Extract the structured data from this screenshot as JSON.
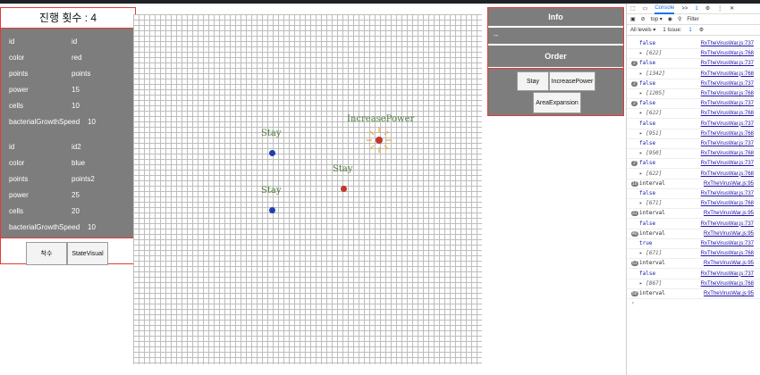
{
  "app": {
    "progress_title": "진행 횟수 : 4"
  },
  "left_panel": {
    "players": [
      {
        "rows": [
          {
            "key": "id",
            "value": "id"
          },
          {
            "key": "color",
            "value": "red"
          },
          {
            "key": "points",
            "value": "points"
          },
          {
            "key": "power",
            "value": "15"
          },
          {
            "key": "cells",
            "value": "10"
          },
          {
            "key": "bacterialGrowthSpeed",
            "value": "10"
          }
        ]
      },
      {
        "rows": [
          {
            "key": "id",
            "value": "id2"
          },
          {
            "key": "color",
            "value": "blue"
          },
          {
            "key": "points",
            "value": "points2"
          },
          {
            "key": "power",
            "value": "25"
          },
          {
            "key": "cells",
            "value": "20"
          },
          {
            "key": "bacterialGrowthSpeed",
            "value": "10"
          }
        ]
      }
    ],
    "buttons": {
      "start": "착수",
      "state_visual": "StateVisual"
    }
  },
  "map": {
    "labels": {
      "blue_top": "Stay",
      "blue_bottom": "Stay",
      "red_top": "IncreasePower",
      "red_bottom": "Stay"
    },
    "colors": {
      "blue": "#1f3fae",
      "red": "#c0392b",
      "label": "#4d7a3e",
      "burst": "#f5a623"
    }
  },
  "right_panel": {
    "info_title": "Info",
    "info_text": "--",
    "order_title": "Order",
    "buttons": {
      "stay": "Stay",
      "increase_power": "IncreasePower",
      "area_expansion": "AreaExpansion"
    }
  },
  "devtools": {
    "tabs": {
      "console": "Console",
      "more": ">>",
      "issues_count": "1"
    },
    "context": "top ▾",
    "filter_placeholder": "Filter",
    "levels": "All levels ▾",
    "issues_label": "1 Issue:",
    "issues_badge": "1",
    "logs": [
      {
        "badge": "",
        "msg": "false",
        "kind": "val",
        "src": "RxTheVirusWar.js:737"
      },
      {
        "badge": "",
        "msg": "▸ [622]",
        "kind": "arr",
        "src": "RxTheVirusWar.js:768"
      },
      {
        "badge": "2",
        "msg": "false",
        "kind": "val",
        "src": "RxTheVirusWar.js:737"
      },
      {
        "badge": "",
        "msg": "▸ [1342]",
        "kind": "arr",
        "src": "RxTheVirusWar.js:768"
      },
      {
        "badge": "2",
        "msg": "false",
        "kind": "val",
        "src": "RxTheVirusWar.js:737"
      },
      {
        "badge": "",
        "msg": "▸ [1205]",
        "kind": "arr",
        "src": "RxTheVirusWar.js:768"
      },
      {
        "badge": "2",
        "msg": "false",
        "kind": "val",
        "src": "RxTheVirusWar.js:737"
      },
      {
        "badge": "",
        "msg": "▸ [622]",
        "kind": "arr",
        "src": "RxTheVirusWar.js:768"
      },
      {
        "badge": "",
        "msg": "false",
        "kind": "val",
        "src": "RxTheVirusWar.js:737"
      },
      {
        "badge": "",
        "msg": "▸ [951]",
        "kind": "arr",
        "src": "RxTheVirusWar.js:768"
      },
      {
        "badge": "",
        "msg": "false",
        "kind": "val",
        "src": "RxTheVirusWar.js:737"
      },
      {
        "badge": "",
        "msg": "▸ [950]",
        "kind": "arr",
        "src": "RxTheVirusWar.js:768"
      },
      {
        "badge": "2",
        "msg": "false",
        "kind": "val",
        "src": "RxTheVirusWar.js:737"
      },
      {
        "badge": "",
        "msg": "▸ [622]",
        "kind": "arr",
        "src": "RxTheVirusWar.js:768"
      },
      {
        "badge": "10",
        "msg": "interval",
        "kind": "plain",
        "src": "RxTheVirusWar.js:95"
      },
      {
        "badge": "",
        "msg": "false",
        "kind": "val",
        "src": "RxTheVirusWar.js:737"
      },
      {
        "badge": "",
        "msg": "▸ [671]",
        "kind": "arr",
        "src": "RxTheVirusWar.js:768"
      },
      {
        "badge": "31",
        "msg": "interval",
        "kind": "plain",
        "src": "RxTheVirusWar.js:95"
      },
      {
        "badge": "",
        "msg": "false",
        "kind": "val",
        "src": "RxTheVirusWar.js:737"
      },
      {
        "badge": "40",
        "msg": "interval",
        "kind": "plain",
        "src": "RxTheVirusWar.js:95"
      },
      {
        "badge": "",
        "msg": "true",
        "kind": "val",
        "src": "RxTheVirusWar.js:737"
      },
      {
        "badge": "",
        "msg": "▸ [671]",
        "kind": "arr",
        "src": "RxTheVirusWar.js:768"
      },
      {
        "badge": "51",
        "msg": "interval",
        "kind": "plain",
        "src": "RxTheVirusWar.js:95"
      },
      {
        "badge": "",
        "msg": "false",
        "kind": "val",
        "src": "RxTheVirusWar.js:737"
      },
      {
        "badge": "",
        "msg": "▸ [867]",
        "kind": "arr",
        "src": "RxTheVirusWar.js:768"
      },
      {
        "badge": "59",
        "msg": "interval",
        "kind": "plain",
        "src": "RxTheVirusWar.js:95"
      }
    ]
  }
}
